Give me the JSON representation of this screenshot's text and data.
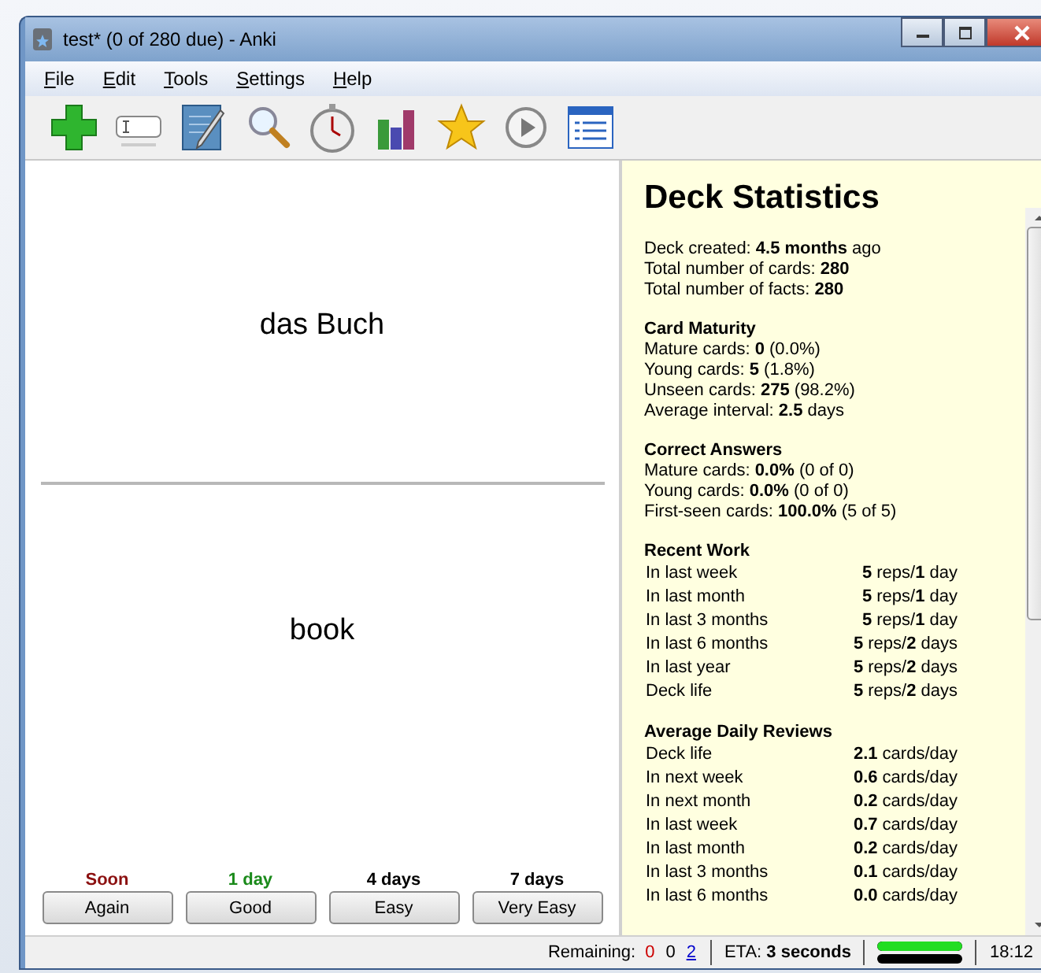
{
  "window": {
    "title": "test* (0 of 280 due) - Anki"
  },
  "menu": [
    {
      "label": "File"
    },
    {
      "label": "Edit"
    },
    {
      "label": "Tools"
    },
    {
      "label": "Settings"
    },
    {
      "label": "Help"
    }
  ],
  "card": {
    "question": "das Buch",
    "answer": "book"
  },
  "answer_buttons": [
    {
      "interval": "Soon",
      "color": "#8b1010",
      "label": "Again"
    },
    {
      "interval": "1 day",
      "color": "#1a8a1a",
      "label": "Good"
    },
    {
      "interval": "4 days",
      "color": "#000000",
      "label": "Easy"
    },
    {
      "interval": "7 days",
      "color": "#000000",
      "label": "Very Easy"
    }
  ],
  "stats": {
    "title": "Deck Statistics",
    "sections": [
      {
        "kind": "lines",
        "lines": [
          "Deck created: **4.5 months** ago",
          "Total number of cards: **280**",
          "Total number of facts: **280**"
        ]
      },
      {
        "kind": "lines",
        "heading": "Card Maturity",
        "lines": [
          "Mature cards: **0** (0.0%)",
          "Young cards: **5** (1.8%)",
          "Unseen cards: **275** (98.2%)",
          "Average interval: **2.5** days"
        ]
      },
      {
        "kind": "lines",
        "heading": "Correct Answers",
        "lines": [
          "Mature cards: **0.0%** (0 of 0)",
          "Young cards: **0.0%** (0 of 0)",
          "First-seen cards: **100.0%** (5 of 5)"
        ]
      },
      {
        "kind": "table",
        "heading": "Recent Work",
        "rows": [
          {
            "label": "In last week",
            "value": "**5** reps/**1** day"
          },
          {
            "label": "In last month",
            "value": "**5** reps/**1** day"
          },
          {
            "label": "In last 3 months",
            "value": "**5** reps/**1** day"
          },
          {
            "label": "In last 6 months",
            "value": "**5** reps/**2** days"
          },
          {
            "label": "In last year",
            "value": "**5** reps/**2** days"
          },
          {
            "label": "Deck life",
            "value": "**5** reps/**2** days"
          }
        ]
      },
      {
        "kind": "table",
        "heading": "Average Daily Reviews",
        "rows": [
          {
            "label": "Deck life",
            "value": "**2.1** cards/day"
          },
          {
            "label": "In next week",
            "value": "**0.6** cards/day"
          },
          {
            "label": "In next month",
            "value": "**0.2** cards/day"
          },
          {
            "label": "In last week",
            "value": "**0.7** cards/day"
          },
          {
            "label": "In last month",
            "value": "**0.2** cards/day"
          },
          {
            "label": "In last 3 months",
            "value": "**0.1** cards/day"
          },
          {
            "label": "In last 6 months",
            "value": "**0.0** cards/day"
          }
        ]
      }
    ]
  },
  "status_bar": {
    "remaining_label": "Remaining:",
    "remaining": [
      {
        "count": "0",
        "color": "#cc0000"
      },
      {
        "count": "0",
        "color": "#000000"
      },
      {
        "count": "2",
        "color": "#0000cc"
      }
    ],
    "eta": "ETA: **3 seconds**",
    "progress": {
      "level": 1
    },
    "time": "18:12"
  }
}
